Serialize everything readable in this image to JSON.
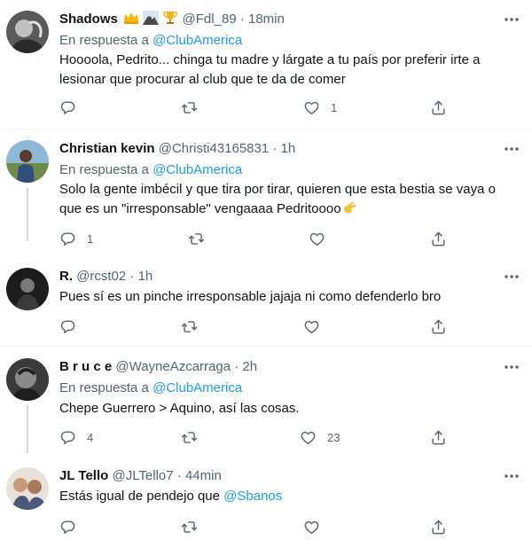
{
  "tweets": [
    {
      "name": "Shadows",
      "badges": [
        "crown-emoji",
        "mountain-emoji",
        "trophy-emoji"
      ],
      "handle": "@Fdl_89",
      "time": "· 18min",
      "reply_prefix": "En respuesta a",
      "reply_to": "@ClubAmerica",
      "text": "Hoooola, Pedrito... chinga tu madre y lárgate a tu país por preferir irte a lesionar que procurar al club que te da de comer",
      "likes": "1"
    },
    {
      "name": "Christian kevin",
      "handle": "@Christi43165831",
      "time": "· 1h",
      "reply_prefix": "En respuesta a",
      "reply_to": "@ClubAmerica",
      "text": "Solo la gente imbécil y que tira por tirar, quieren que esta bestia se vaya o que es un \"irresponsable\" vengaaaa Pedritoooo",
      "text_emoji": "hand-emoji",
      "replies": "1"
    },
    {
      "name": "R.",
      "handle": "@rcst02",
      "time": "· 1h",
      "text": "Pues sí es un pinche irresponsable jajaja ni como defenderlo bro"
    },
    {
      "name": "B r u c e",
      "handle": "@WayneAzcarraga",
      "time": "· 2h",
      "reply_prefix": "En respuesta a",
      "reply_to": "@ClubAmerica",
      "text": "Chepe Guerrero > Aquino, así las cosas.",
      "replies": "4",
      "likes": "23"
    },
    {
      "name": "JL Tello",
      "handle": "@JLTello7",
      "time": "· 44min",
      "text_prefix": "Estás igual de pendejo que",
      "text_mention": "@Sbanos"
    }
  ],
  "colors": {
    "accent": "#1d9bf0",
    "muted": "#536471",
    "divider": "#eff3f4",
    "thread": "#cfd9de"
  }
}
